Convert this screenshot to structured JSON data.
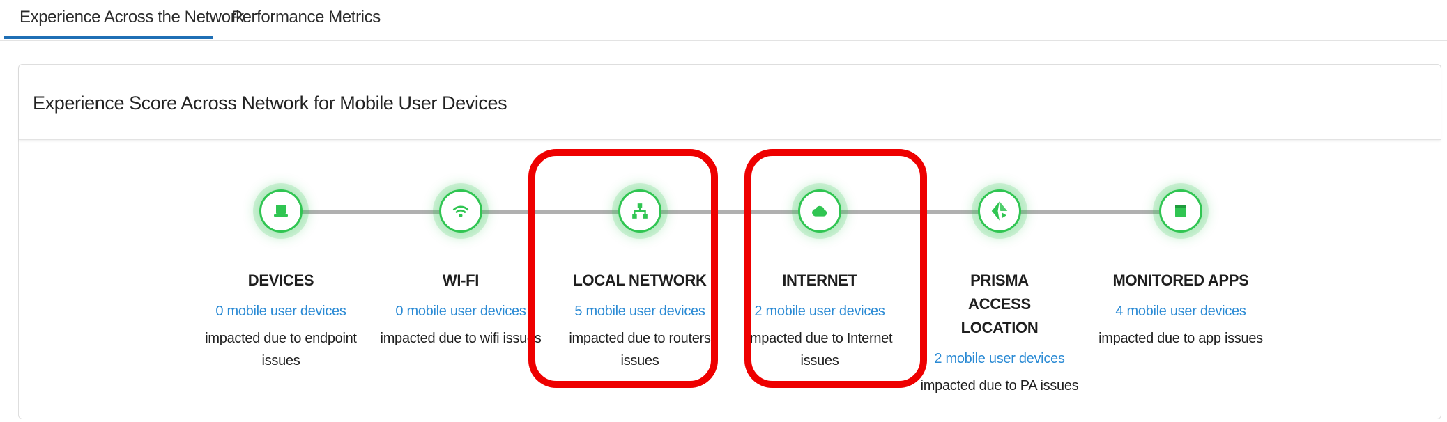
{
  "tabs": [
    {
      "label": "Experience Across the Network",
      "active": true
    },
    {
      "label": "Performance Metrics",
      "active": false
    }
  ],
  "card": {
    "title": "Experience Score Across Network for Mobile User Devices"
  },
  "colors": {
    "status_good": "#30c552",
    "link": "#2a8ad4",
    "highlight": "#ee0000",
    "tab_active": "#1f6fb5"
  },
  "nodes": [
    {
      "icon": "laptop-icon",
      "title": "DEVICES",
      "link": "0 mobile user devices",
      "desc": "impacted due to endpoint issues",
      "highlighted": false
    },
    {
      "icon": "wifi-icon",
      "title": "WI-FI",
      "link": "0 mobile user devices",
      "desc": "impacted due to wifi issues",
      "highlighted": false
    },
    {
      "icon": "network-icon",
      "title": "LOCAL NETWORK",
      "link": "5 mobile user devices",
      "desc": "impacted due to routers issues",
      "highlighted": true
    },
    {
      "icon": "cloud-icon",
      "title": "INTERNET",
      "link": "2 mobile user devices",
      "desc": "impacted due to Internet issues",
      "highlighted": true
    },
    {
      "icon": "prisma-access-icon",
      "title": "PRISMA ACCESS LOCATION",
      "link": "2 mobile user devices",
      "desc": "impacted due to PA issues",
      "highlighted": false
    },
    {
      "icon": "app-icon",
      "title": "MONITORED APPS",
      "link": "4 mobile user devices",
      "desc": "impacted due to app issues",
      "highlighted": false
    }
  ]
}
